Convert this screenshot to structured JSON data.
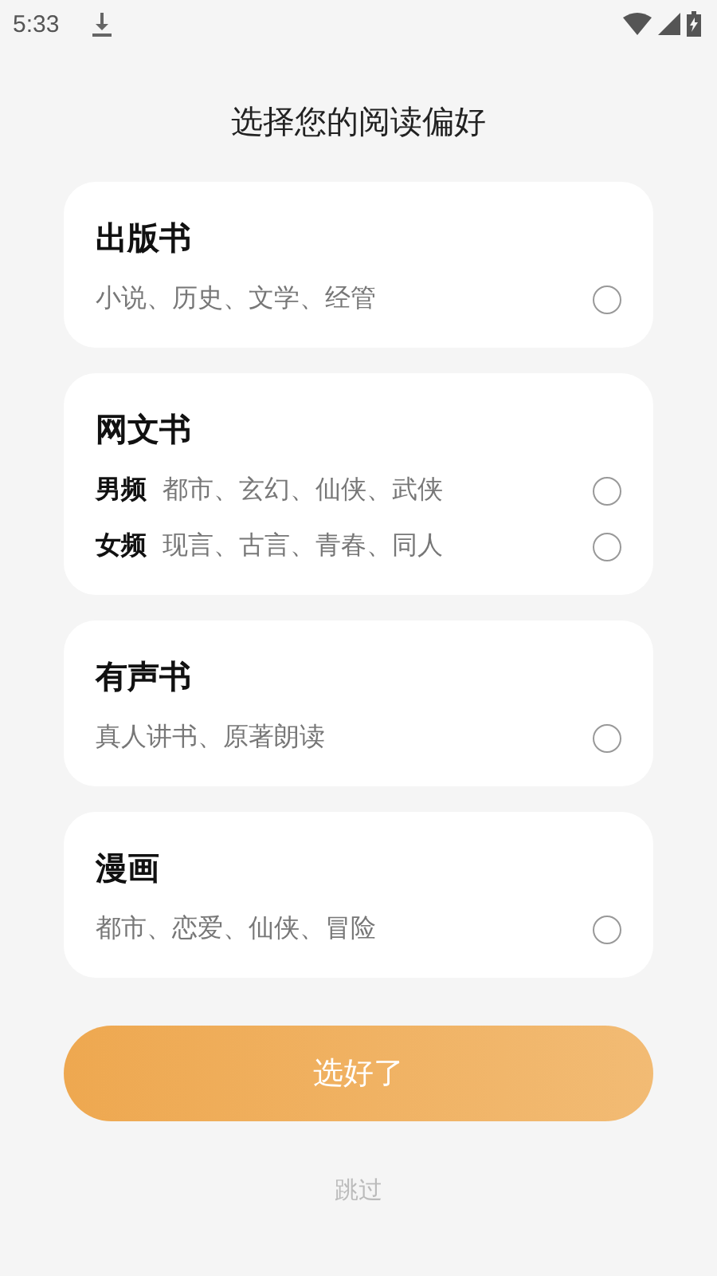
{
  "status_bar": {
    "time": "5:33"
  },
  "title": "选择您的阅读偏好",
  "categories": [
    {
      "title": "出版书",
      "options": [
        {
          "genres": "小说、历史、文学、经管",
          "selected": false
        }
      ]
    },
    {
      "title": "网文书",
      "options": [
        {
          "label": "男频",
          "genres": "都市、玄幻、仙侠、武侠",
          "selected": false
        },
        {
          "label": "女频",
          "genres": "现言、古言、青春、同人",
          "selected": false
        }
      ]
    },
    {
      "title": "有声书",
      "options": [
        {
          "genres": "真人讲书、原著朗读",
          "selected": false
        }
      ]
    },
    {
      "title": "漫画",
      "options": [
        {
          "genres": "都市、恋爱、仙侠、冒险",
          "selected": false
        }
      ]
    }
  ],
  "confirm_button": {
    "label": "选好了",
    "disabled": true
  },
  "skip_link": "跳过"
}
